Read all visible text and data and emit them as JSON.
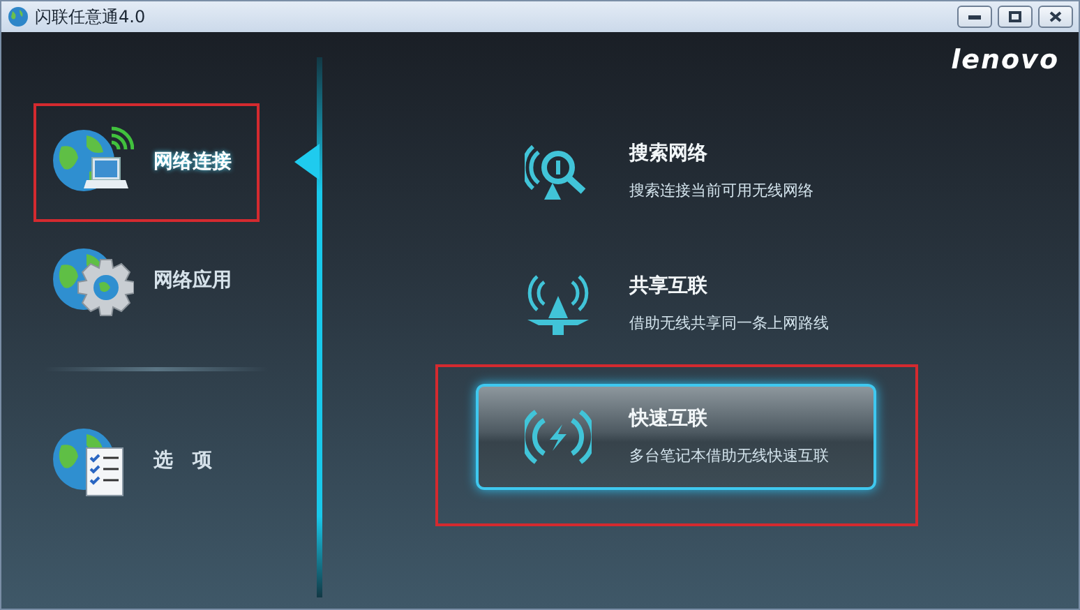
{
  "window": {
    "title": "闪联任意通4.0",
    "logo": "lenovo"
  },
  "sidebar": {
    "items": [
      {
        "label": "网络连接",
        "selected": true,
        "highlighted": true
      },
      {
        "label": "网络应用",
        "selected": false,
        "highlighted": false
      },
      {
        "label": "选　项",
        "selected": false,
        "highlighted": false
      }
    ]
  },
  "actions": [
    {
      "title": "搜索网络",
      "description": "搜索连接当前可用无线网络",
      "selected": false,
      "highlighted": false
    },
    {
      "title": "共享互联",
      "description": "借助无线共享同一条上网路线",
      "selected": false,
      "highlighted": false
    },
    {
      "title": "快速互联",
      "description": "多台笔记本借助无线快速互联",
      "selected": true,
      "highlighted": true
    }
  ]
}
